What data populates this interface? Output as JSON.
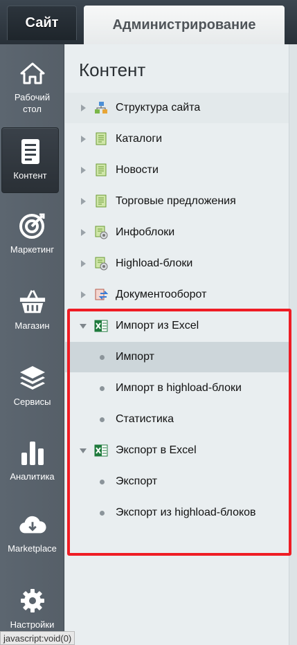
{
  "topbar": {
    "tabs": [
      {
        "label": "Сайт"
      },
      {
        "label": "Администрирование"
      }
    ]
  },
  "leftnav": {
    "items": [
      {
        "label": "Рабочий стол",
        "icon": "home-icon"
      },
      {
        "label": "Контент",
        "icon": "document-icon"
      },
      {
        "label": "Маркетинг",
        "icon": "target-icon"
      },
      {
        "label": "Магазин",
        "icon": "basket-icon"
      },
      {
        "label": "Сервисы",
        "icon": "layers-icon"
      },
      {
        "label": "Аналитика",
        "icon": "bar-chart-icon"
      },
      {
        "label": "Marketplace",
        "icon": "cloud-download-icon"
      },
      {
        "label": "Настройки",
        "icon": "gear-icon"
      }
    ]
  },
  "panel": {
    "title": "Контент",
    "tree": [
      {
        "label": "Структура сайта",
        "icon": "site-structure-icon",
        "expanded": false
      },
      {
        "label": "Каталоги",
        "icon": "catalog-icon",
        "expanded": false
      },
      {
        "label": "Новости",
        "icon": "news-icon",
        "expanded": false
      },
      {
        "label": "Торговые предложения",
        "icon": "offers-icon",
        "expanded": false
      },
      {
        "label": "Инфоблоки",
        "icon": "infoblock-icon",
        "expanded": false
      },
      {
        "label": "Highload-блоки",
        "icon": "highload-icon",
        "expanded": false
      },
      {
        "label": "Документооборот",
        "icon": "workflow-icon",
        "expanded": false
      },
      {
        "label": "Импорт из Excel",
        "icon": "excel-icon",
        "expanded": true,
        "children": [
          {
            "label": "Импорт",
            "selected": true
          },
          {
            "label": "Импорт в highload-блоки",
            "selected": false
          },
          {
            "label": "Статистика",
            "selected": false
          }
        ]
      },
      {
        "label": "Экспорт в Excel",
        "icon": "excel-icon",
        "expanded": true,
        "children": [
          {
            "label": "Экспорт",
            "selected": false
          },
          {
            "label": "Экспорт из highload-блоков",
            "selected": false
          }
        ]
      }
    ]
  },
  "statusbar": {
    "text": "javascript:void(0)"
  },
  "colors": {
    "highlight_box": "#ef1c24",
    "excel_green": "#1e7a3c"
  }
}
